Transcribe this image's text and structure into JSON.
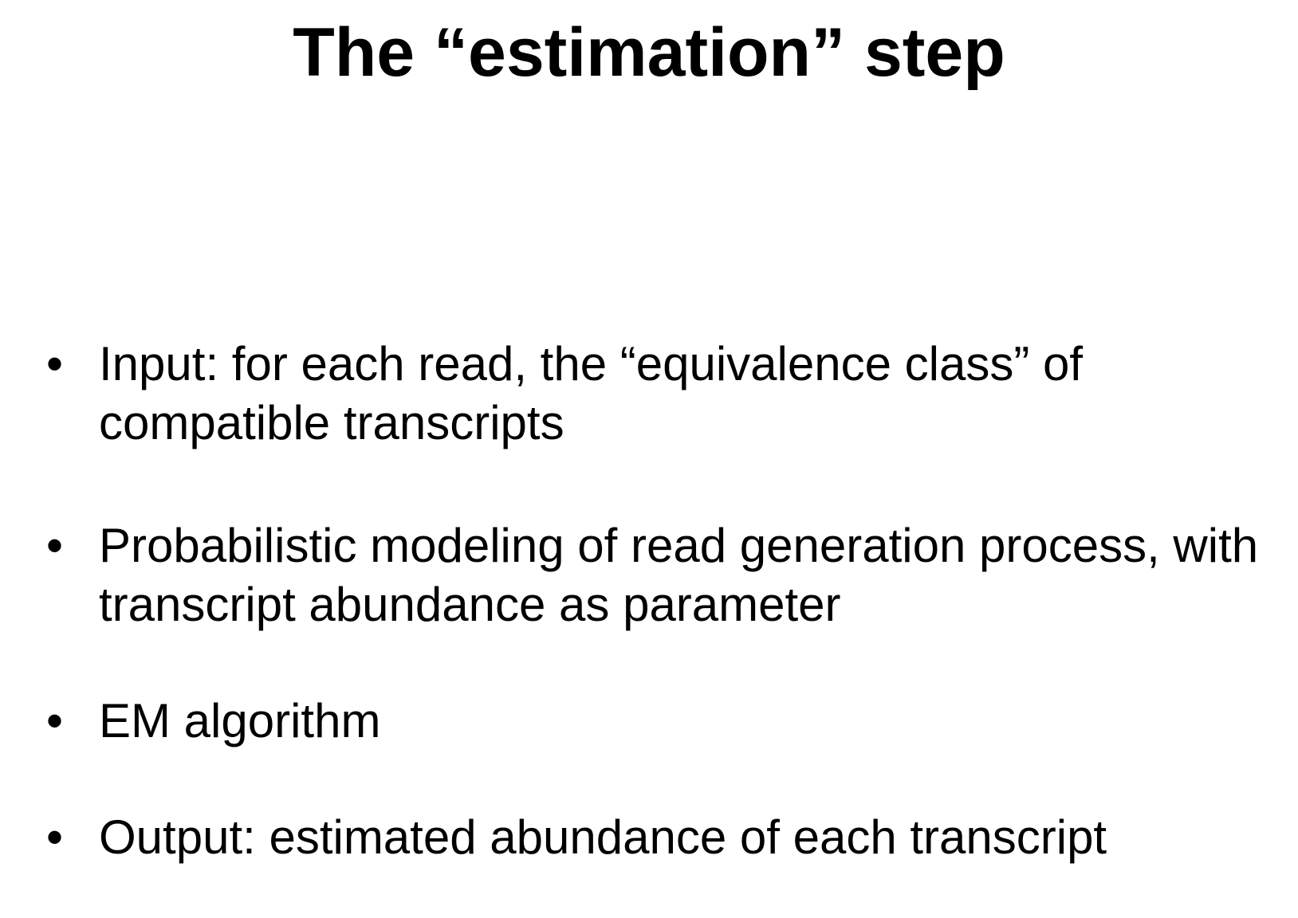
{
  "slide": {
    "title": "The “estimation” step",
    "bullet_glyph": "•",
    "bullets": [
      {
        "text": "Input: for each read, the “equivalence class” of compatible transcripts"
      },
      {
        "text": "Probabilistic modeling of read generation process, with transcript abundance as parameter"
      },
      {
        "text": "EM algorithm"
      },
      {
        "text": "Output: estimated abundance of each transcript"
      }
    ]
  }
}
